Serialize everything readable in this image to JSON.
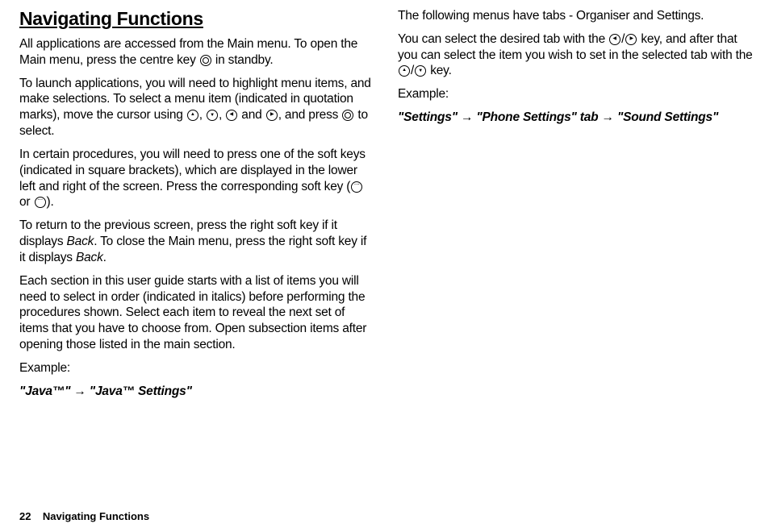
{
  "heading": "Navigating Functions",
  "col1": {
    "p1a": "All applications are accessed from the Main menu. To open the Main menu, press the centre key ",
    "p1b": " in standby.",
    "p2a": "To launch applications, you will need to highlight menu items, and make selections. To select a menu item (indicated in quotation marks), move the cursor using ",
    "p2b": ", ",
    "p2c": ", ",
    "p2d": " and ",
    "p2e": ", and press ",
    "p2f": " to select.",
    "p3a": "In certain procedures, you will need to press one of the soft keys (indicated in square brackets), which are displayed in the lower left and right of the screen. Press the corresponding soft key (",
    "p3b": " or ",
    "p3c": ").",
    "p4a": "To return to the previous screen, press the right soft key if it displays ",
    "p4back1": "Back",
    "p4b": ". To close the Main menu, press the right soft key if it displays ",
    "p4back2": "Back",
    "p4c": ".",
    "p5": "Each section in this user guide starts with a list of items you will need to select in order (indicated in italics) before performing the procedures shown. Select each item to reveal the next set of items that you have to choose from. Open subsection items after opening those listed in the main section.",
    "example_label": "Example:",
    "example_path1": "\"Java™\"",
    "example_arrow": " → ",
    "example_path2": "\"Java™ Settings\""
  },
  "col2": {
    "p1": "The following menus have tabs - Organiser and Settings.",
    "p2a": "You can select the desired tab with the ",
    "p2b": "/",
    "p2c": " key, and after that you can select the item you wish to set in the selected tab with the ",
    "p2d": "/",
    "p2e": " key.",
    "example_label": "Example:",
    "ex1": "\"Settings\"",
    "arrow": " → ",
    "ex2": "\"Phone Settings\" tab ",
    "ex3": "\"Sound Settings\""
  },
  "footer": {
    "page": "22",
    "title": "Navigating Functions"
  }
}
